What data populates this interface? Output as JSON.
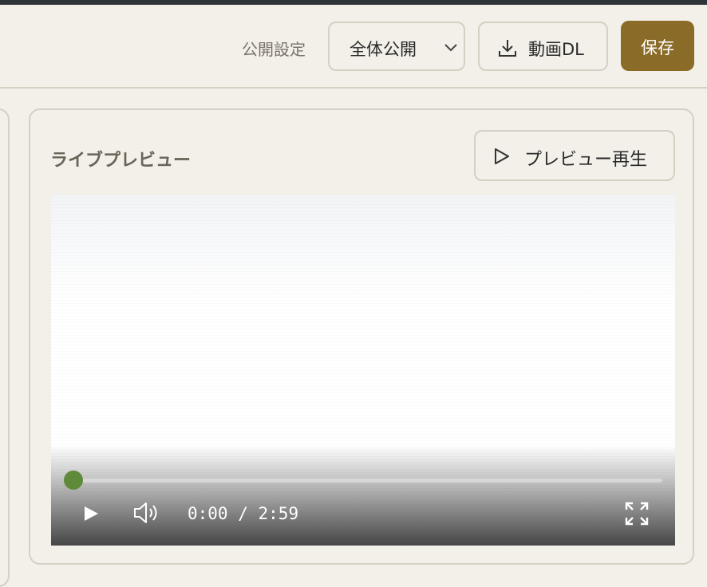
{
  "header": {
    "visibility_label": "公開設定",
    "visibility_value": "全体公開",
    "download_label": "動画DL",
    "save_label": "保存"
  },
  "preview_card": {
    "title": "ライブプレビュー",
    "play_preview_label": "プレビュー再生"
  },
  "video": {
    "current_time": "0:00",
    "separator": " / ",
    "duration": "2:59",
    "progress": 0.0
  },
  "colors": {
    "accent": "#8b6b28",
    "progress": "#5e8a3a",
    "border": "#d6d0c3",
    "background": "#f3efe9"
  },
  "icons": {
    "select": "chevron-down-icon",
    "download": "download-icon",
    "preview": "play-outline-icon",
    "play": "play-icon",
    "volume": "volume-icon",
    "fullscreen": "fullscreen-icon"
  }
}
